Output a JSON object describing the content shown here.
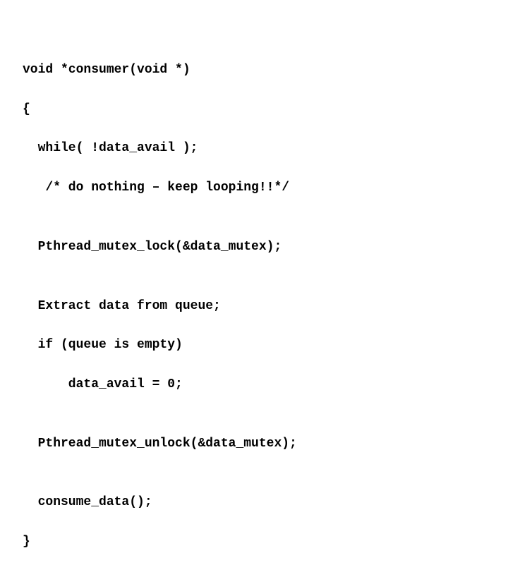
{
  "code": {
    "lines": [
      "void *consumer(void *)",
      "{",
      "  while( !data_avail );",
      "   /* do nothing – keep looping!!*/",
      "",
      "  Pthread_mutex_lock(&data_mutex);",
      "",
      "  Extract data from queue;",
      "  if (queue is empty)",
      "      data_avail = 0;",
      "",
      "  Pthread_mutex_unlock(&data_mutex);",
      "",
      "  consume_data();",
      "}"
    ]
  }
}
